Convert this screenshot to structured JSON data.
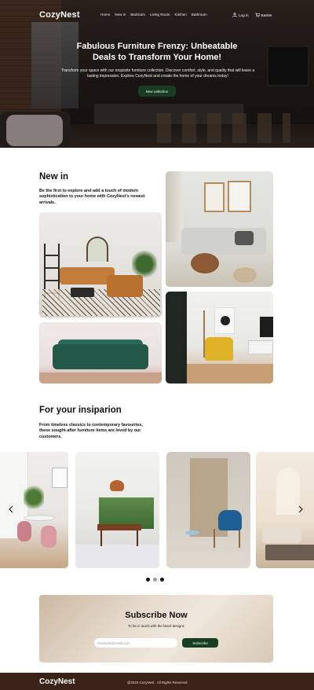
{
  "nav": {
    "logo": "CozyNest",
    "menu": [
      "Home",
      "New in",
      "Bedroom",
      "Living Room",
      "Kitchen",
      "Bathroom"
    ],
    "login": "Log in",
    "basket": "Basket"
  },
  "hero": {
    "title": "Fabulous Furniture Frenzy: Unbeatable Deals to Transform Your Home!",
    "text": "Transform your space with our exquisite furniture collection. Discover comfort, style, and quality that will leave a lasting impression. Explore CozyNest and create the home of your dreams today!",
    "button": "New collection"
  },
  "new_in": {
    "title": "New in",
    "text": "Be the first to explore and add a touch of modern sophistication to your home with CozyNest's newest arrivals."
  },
  "inspiration": {
    "title": "For your insiparion",
    "text": "From timeless classics to contemporary favourites, these sought-after furniture items are loved by our customers."
  },
  "subscribe": {
    "title": "Subscribe Now",
    "text": "To be in touch with the latest designs",
    "placeholder": "Example@email.com",
    "button": "Subscribe"
  },
  "footer": {
    "logo": "CozyNest",
    "copyright": "@2023 CozyNest . All Rights Reserved"
  },
  "icons": {
    "login": "user-icon",
    "basket": "cart-icon",
    "prev": "chevron-left-icon",
    "next": "chevron-right-icon"
  },
  "colors": {
    "accent_green": "#173d22",
    "footer_brown": "#3b2219"
  }
}
